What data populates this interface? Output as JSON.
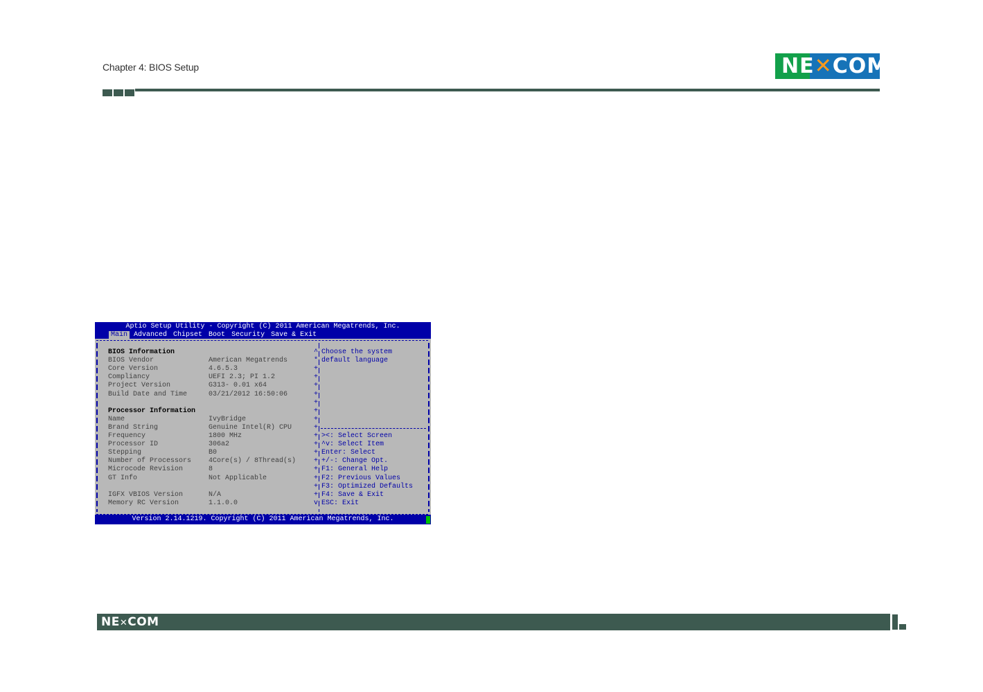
{
  "header": {
    "chapter_title": "Chapter 4: BIOS Setup",
    "logo_text": "NE COM",
    "brand_colors": {
      "green": "#12a04a",
      "blue": "#1673b8",
      "rule": "#3d5a50"
    }
  },
  "bios": {
    "title": "Aptio Setup Utility - Copyright (C) 2011 American Megatrends, Inc.",
    "menu": [
      "Main",
      "Advanced",
      "Chipset",
      "Boot",
      "Security",
      "Save & Exit"
    ],
    "active_menu": "Main",
    "rows": [
      {
        "label": "BIOS Information",
        "value": "",
        "head": true,
        "mark": "^"
      },
      {
        "label": "BIOS Vendor",
        "value": "American Megatrends",
        "mark": "*"
      },
      {
        "label": "Core Version",
        "value": "4.6.5.3",
        "mark": "+"
      },
      {
        "label": "Compliancy",
        "value": "UEFI 2.3; PI 1.2",
        "mark": "+"
      },
      {
        "label": "Project Version",
        "value": "G313- 0.01 x64",
        "mark": "+"
      },
      {
        "label": "Build Date and Time",
        "value": "03/21/2012 16:50:06",
        "mark": "+"
      },
      {
        "label": "",
        "value": "",
        "mark": "+"
      },
      {
        "label": "Processor Information",
        "value": "",
        "head": true,
        "mark": "+"
      },
      {
        "label": "Name",
        "value": "IvyBridge",
        "mark": "+"
      },
      {
        "label": "Brand String",
        "value": "Genuine Intel(R) CPU",
        "mark": "+"
      },
      {
        "label": "Frequency",
        "value": "1800 MHz",
        "mark": "+"
      },
      {
        "label": "Processor ID",
        "value": "306a2",
        "mark": "+"
      },
      {
        "label": "Stepping",
        "value": "B0",
        "mark": "+"
      },
      {
        "label": "Number of Processors",
        "value": "4Core(s) / 8Thread(s)",
        "mark": "+"
      },
      {
        "label": "Microcode Revision",
        "value": "8",
        "mark": "+"
      },
      {
        "label": "GT Info",
        "value": "Not Applicable",
        "mark": "+"
      },
      {
        "label": "",
        "value": "",
        "mark": "+"
      },
      {
        "label": "IGFX VBIOS Version",
        "value": "N/A",
        "mark": "+"
      },
      {
        "label": "Memory RC Version",
        "value": "1.1.0.0",
        "mark": "v"
      }
    ],
    "help_text": [
      "Choose the system",
      "default language"
    ],
    "key_help": [
      "><: Select Screen",
      "^v: Select Item",
      "Enter: Select",
      "+/-: Change Opt.",
      "F1: General Help",
      "F2: Previous Values",
      "F3: Optimized Defaults",
      "F4: Save & Exit",
      "ESC: Exit"
    ],
    "footer": "Version 2.14.1219. Copyright (C) 2011 American Megatrends, Inc."
  },
  "footer_bar": {
    "logo_text": "NE COM"
  }
}
